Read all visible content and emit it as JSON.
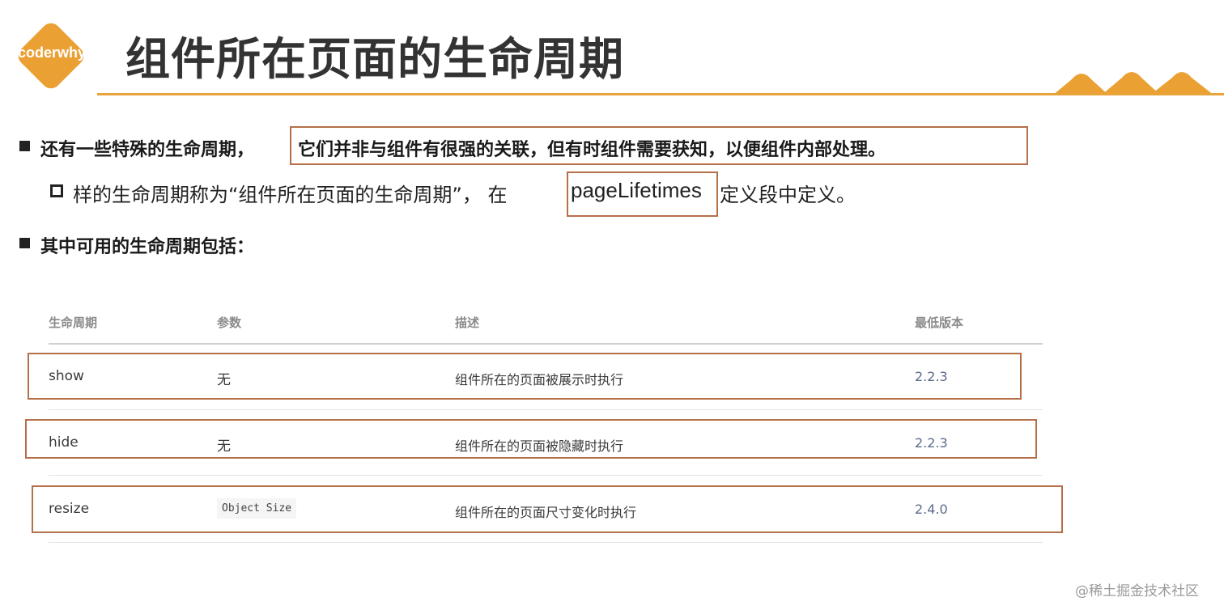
{
  "header": {
    "logo_text": "coderwhy",
    "title": "组件所在页面的生命周期"
  },
  "bullets": {
    "first_plain": "还有一些特殊的生命周期，",
    "first_highlight": "它们并非与组件有很强的关联，但有时组件需要获知，以便组件内部处理。",
    "sub_before": "样的生命周期称为“组件所在页面的生命周期”， 在",
    "sub_highlight": "pageLifetimes",
    "sub_after": "定义段中定义。",
    "second": "其中可用的生命周期包括："
  },
  "table": {
    "headers": [
      "生命周期",
      "参数",
      "描述",
      "最低版本"
    ],
    "rows": [
      {
        "name": "show",
        "param": "无",
        "desc": "组件所在的页面被展示时执行",
        "version": "2.2.3"
      },
      {
        "name": "hide",
        "param": "无",
        "desc": "组件所在的页面被隐藏时执行",
        "version": "2.2.3"
      },
      {
        "name": "resize",
        "param": "Object Size",
        "desc": "组件所在的页面尺寸变化时执行",
        "version": "2.4.0"
      }
    ]
  },
  "watermark": "@稀土掘金技术社区",
  "colors": {
    "accent_orange": "#e8a33a",
    "highlight_border": "#b5704a",
    "title_text": "#333333"
  }
}
